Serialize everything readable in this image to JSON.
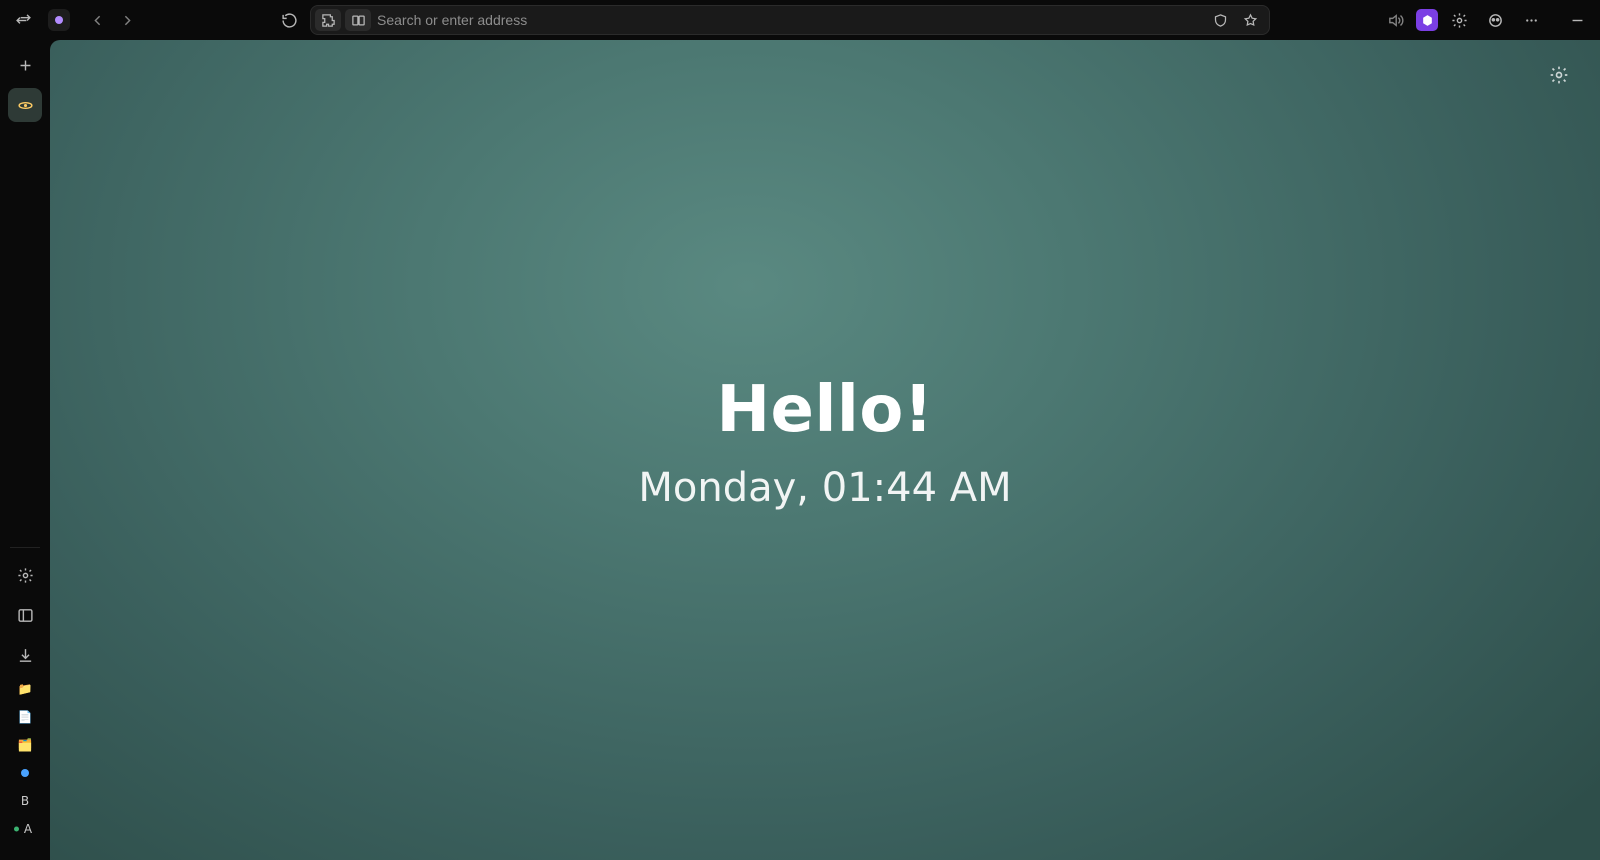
{
  "addressbar": {
    "placeholder": "Search or enter address"
  },
  "newtab": {
    "greeting": "Hello!",
    "datetime": "Monday, 01:44 AM"
  },
  "sidebar_letters": {
    "b": "B",
    "a": "A"
  },
  "icons": {
    "swap": "swap-icon",
    "workspace": "workspace-badge",
    "back": "back-icon",
    "forward": "forward-icon",
    "reload": "reload-icon",
    "extensions": "extensions-icon",
    "split_view": "split-view-icon",
    "shield": "shield-icon",
    "star": "star-icon",
    "audio": "audio-icon",
    "ext1": "extension-hexagon-icon",
    "ext2": "extension-gear-icon",
    "ext3": "extension-privacy-icon",
    "overflow": "overflow-menu-icon",
    "minimize": "minimize-icon",
    "newtab": "new-tab-icon",
    "tab_pinned": "pinned-tab-icon",
    "settings": "gear-icon",
    "sidepanel": "side-panel-icon",
    "downloads": "downloads-icon",
    "folder1": "folder-icon",
    "doc": "document-icon",
    "folder2": "folder-icon-2",
    "circle_blue": "circle-icon",
    "content_settings": "page-settings-icon"
  }
}
